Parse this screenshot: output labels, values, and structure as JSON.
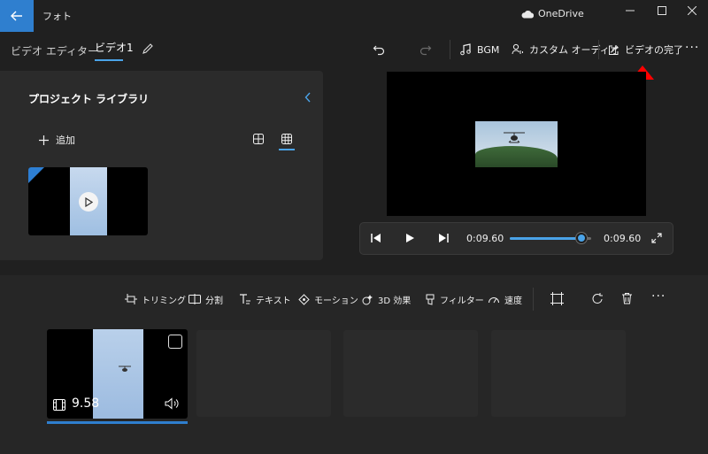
{
  "app": {
    "title": "フォト",
    "onedrive_label": "OneDrive"
  },
  "breadcrumb": {
    "root": "ビデオ エディター",
    "separator": "›",
    "current": "ビデオ1"
  },
  "toolbar": {
    "bgm_label": "BGM",
    "custom_audio_label": "カスタム オーディオ",
    "finish_video_label": "ビデオの完了",
    "more_label": "···"
  },
  "library": {
    "title": "プロジェクト ライブラリ",
    "add_label": "追加"
  },
  "playback": {
    "current_time": "0:09.60",
    "total_time": "0:09.60",
    "progress": 0.88
  },
  "timeline_tools": [
    {
      "label": "トリミング",
      "icon": "trim-icon"
    },
    {
      "label": "分割",
      "icon": "split-icon"
    },
    {
      "label": "テキスト",
      "icon": "text-icon"
    },
    {
      "label": "モーション",
      "icon": "motion-icon"
    },
    {
      "label": "3D 効果",
      "icon": "3d-effects-icon"
    },
    {
      "label": "フィルター",
      "icon": "filter-icon"
    },
    {
      "label": "速度",
      "icon": "speed-icon"
    }
  ],
  "storyboard": {
    "clip1_duration": "9.58"
  },
  "colors": {
    "accent": "#2f7fcf",
    "marker": "#ff0000",
    "background": "#202020"
  }
}
